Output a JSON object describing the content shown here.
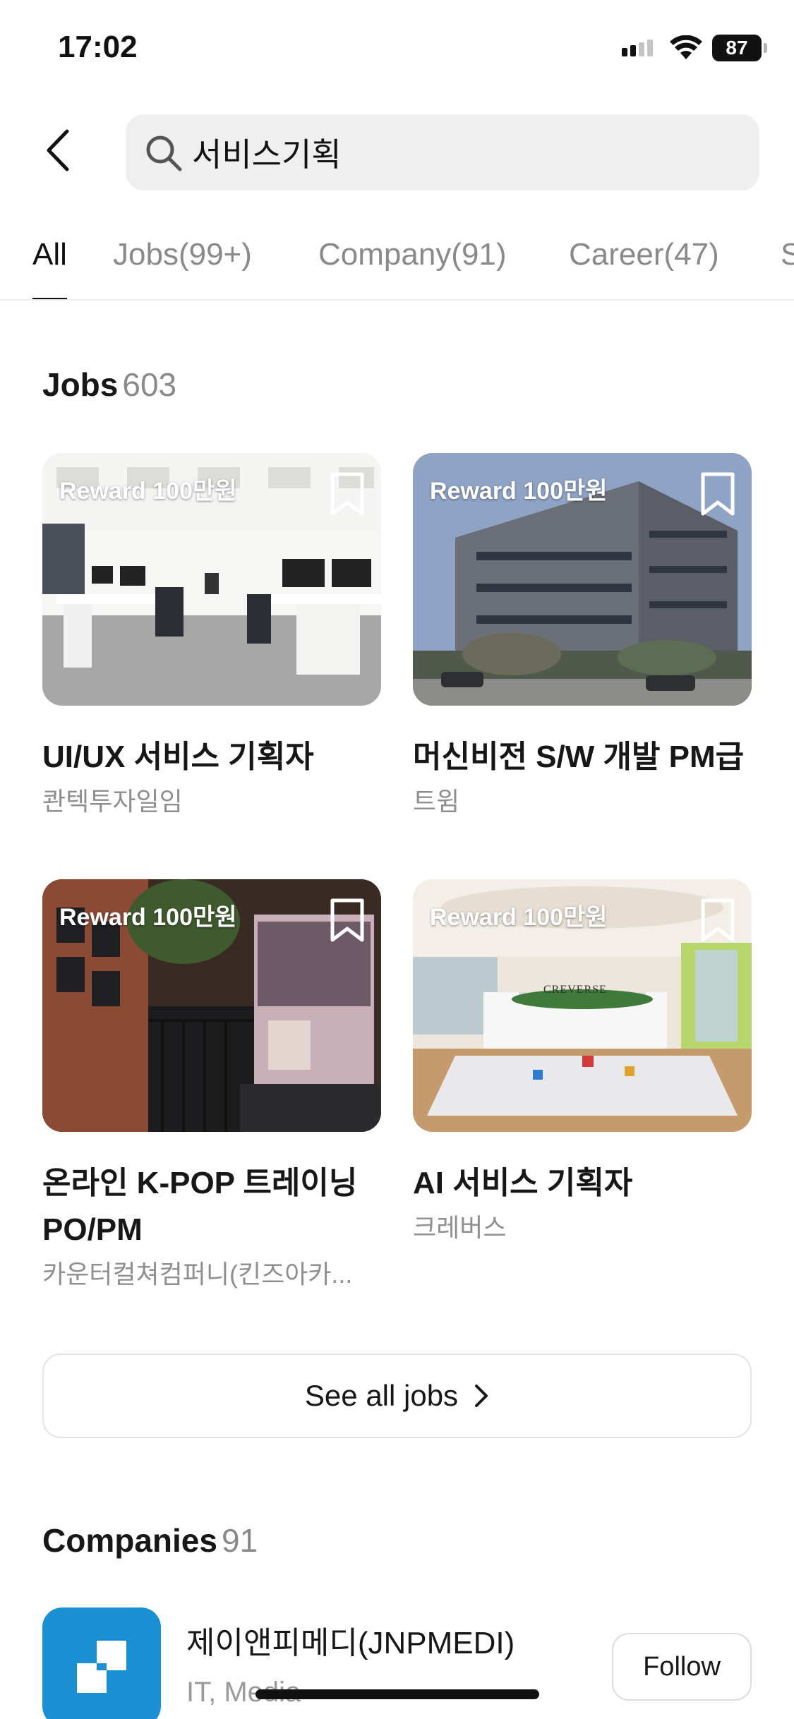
{
  "status_bar": {
    "time": "17:02",
    "battery": "87"
  },
  "search": {
    "query": "서비스기획"
  },
  "tabs": [
    {
      "label": "All"
    },
    {
      "label": "Jobs(99+)"
    },
    {
      "label": "Company(91)"
    },
    {
      "label": "Career(47)"
    },
    {
      "label": "S"
    }
  ],
  "jobs_section": {
    "title": "Jobs",
    "count": "603"
  },
  "jobs": [
    {
      "reward": "Reward 100만원",
      "title": "UI/UX 서비스 기획자",
      "company": "콴텍투자일임",
      "image": "office-interior"
    },
    {
      "reward": "Reward 100만원",
      "title": "머신비전 S/W 개발 PM급",
      "company": "트윔",
      "image": "building-exterior"
    },
    {
      "reward": "Reward 100만원",
      "title": "온라인 K-POP 트레이닝 PO/PM",
      "company": "카운터컬쳐컴퍼니(킨즈아카...",
      "image": "studio-entrance"
    },
    {
      "reward": "Reward 100만원",
      "title": "AI 서비스 기획자",
      "company": "크레버스",
      "image": "office-lounge",
      "sign": "CREVERSE"
    }
  ],
  "see_all": {
    "label": "See all jobs"
  },
  "companies_section": {
    "title": "Companies",
    "count": "91"
  },
  "companies": [
    {
      "name": "제이앤피메디(JNPMEDI)",
      "category": "IT, Media",
      "follow_label": "Follow",
      "logo_color": "#1b8fd4"
    }
  ],
  "colors": {
    "text": "#171717",
    "muted": "#8a8a8a",
    "search_bg": "#efefef",
    "accent_logo": "#1b8fd4"
  }
}
